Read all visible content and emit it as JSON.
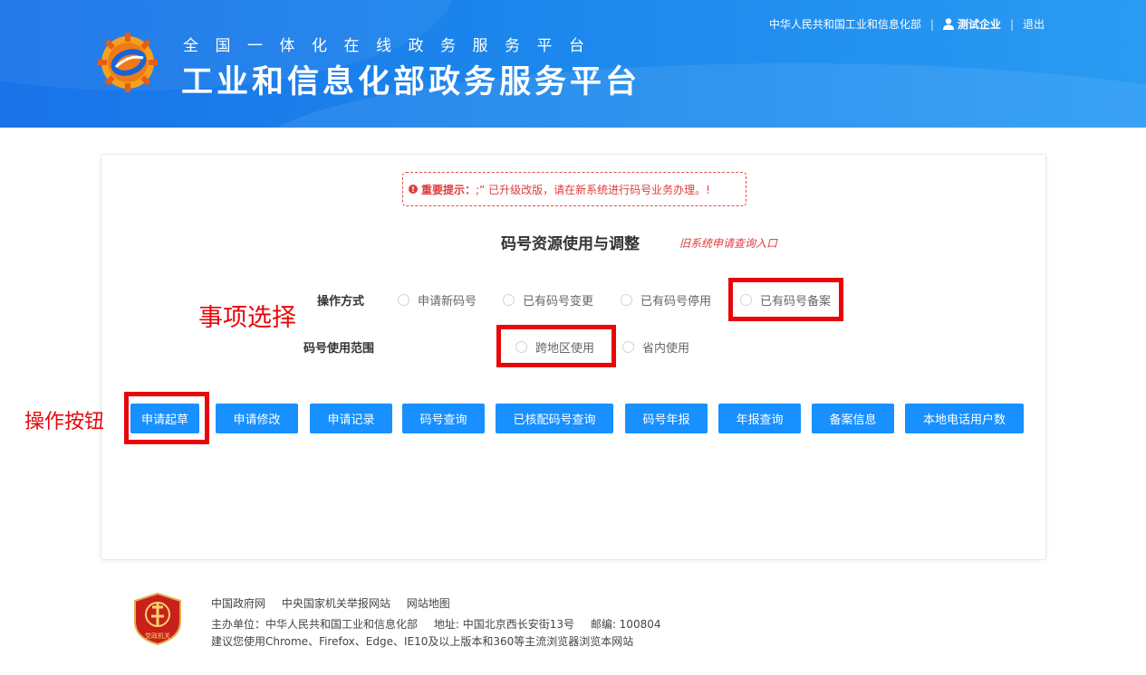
{
  "header": {
    "subtitle": "全国一体化在线政务服务平台",
    "title": "工业和信息化部政务服务平台",
    "ministry_link": "中华人民共和国工业和信息化部",
    "separator": "|",
    "user_name": "测试企业",
    "logout": "退出"
  },
  "notice": {
    "label": "重要提示：",
    "text": ";” 已升级改版，请在新系统进行码号业务办理。!"
  },
  "page": {
    "title": "码号资源使用与调整",
    "old_system_link": "旧系统申请查询入口"
  },
  "form": {
    "operation_label": "操作方式",
    "operation_options": [
      "申请新码号",
      "已有码号变更",
      "已有码号停用",
      "已有码号备案"
    ],
    "scope_label": "码号使用范围",
    "scope_options": [
      "跨地区使用",
      "省内使用"
    ]
  },
  "buttons": [
    "申请起草",
    "申请修改",
    "申请记录",
    "码号查询",
    "已核配码号查询",
    "码号年报",
    "年报查询",
    "备案信息",
    "本地电话用户数"
  ],
  "annotations": {
    "item_selection": "事项选择",
    "operation_buttons": "操作按钮"
  },
  "footer": {
    "links": [
      "中国政府网",
      "中央国家机关举报网站",
      "网站地图"
    ],
    "sponsor": "主办单位：中华人民共和国工业和信息化部",
    "address": "地址: 中国北京西长安街13号",
    "postcode": "邮编: 100804",
    "browser_tip": "建议您使用Chrome、Firefox、Edge、IE10及以上版本和360等主流浏览器浏览本网站",
    "badge_text": "党政机关"
  },
  "colors": {
    "header_blue": "#1a73e8",
    "button_blue": "#1890ff",
    "annotation_red": "#e8060b",
    "notice_red": "#e03a3a"
  }
}
